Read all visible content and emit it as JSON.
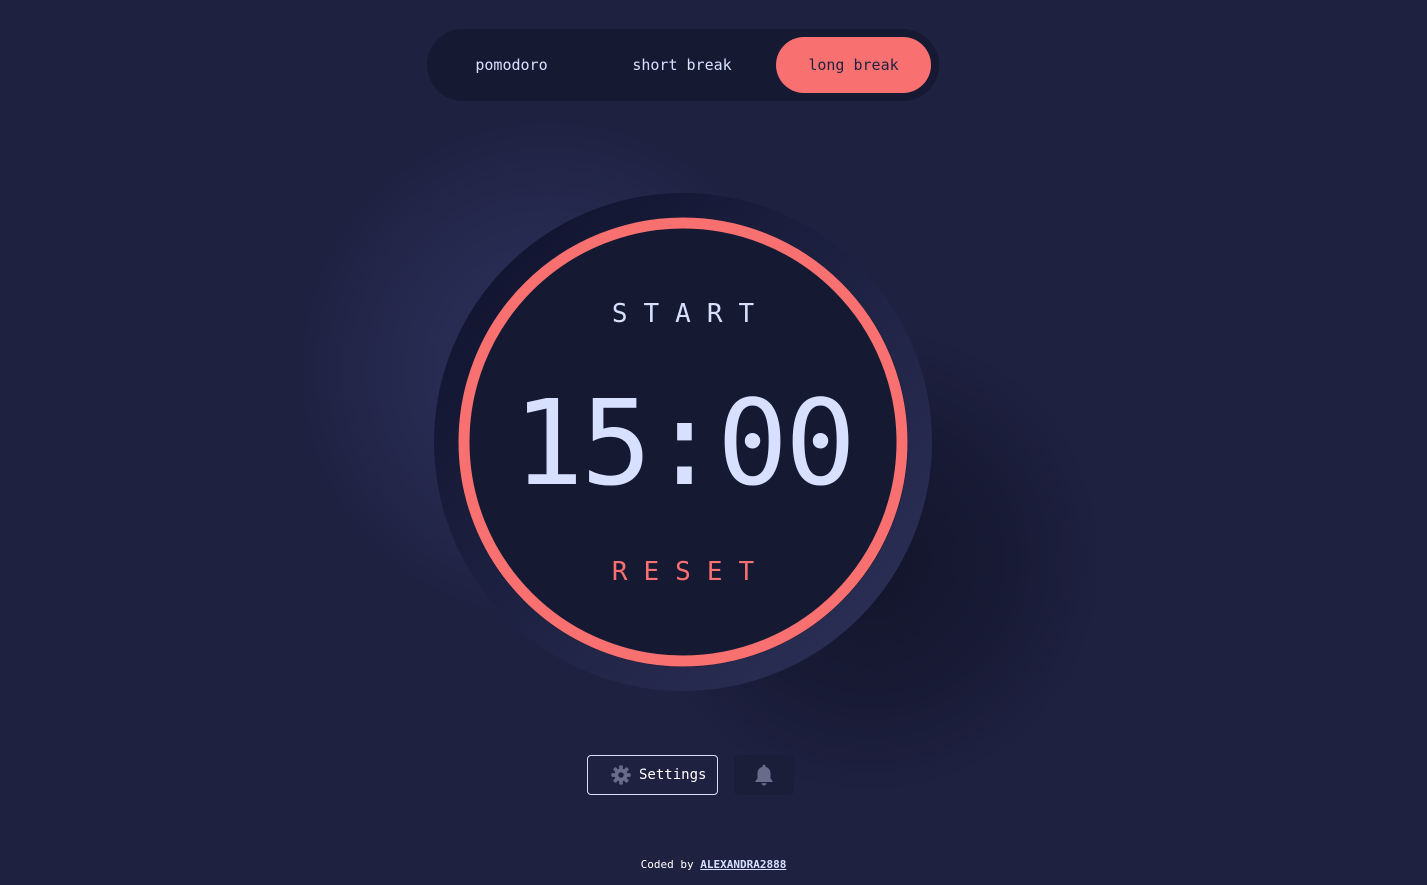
{
  "modes": [
    {
      "label": "pomodoro",
      "active": false
    },
    {
      "label": "short break",
      "active": false
    },
    {
      "label": "long break",
      "active": true
    }
  ],
  "timer": {
    "start_label": "START",
    "time": "15:00",
    "reset_label": "RESET",
    "progress": 1.0
  },
  "controls": {
    "settings_label": "Settings",
    "settings_icon": "gear-icon",
    "bell_icon": "bell-icon"
  },
  "footer": {
    "prefix": "Coded by",
    "author": "ALEXANDRA2888"
  },
  "colors": {
    "background": "#1e2140",
    "accent": "#f87070",
    "text": "#d7e0ff",
    "panel": "#161932"
  }
}
